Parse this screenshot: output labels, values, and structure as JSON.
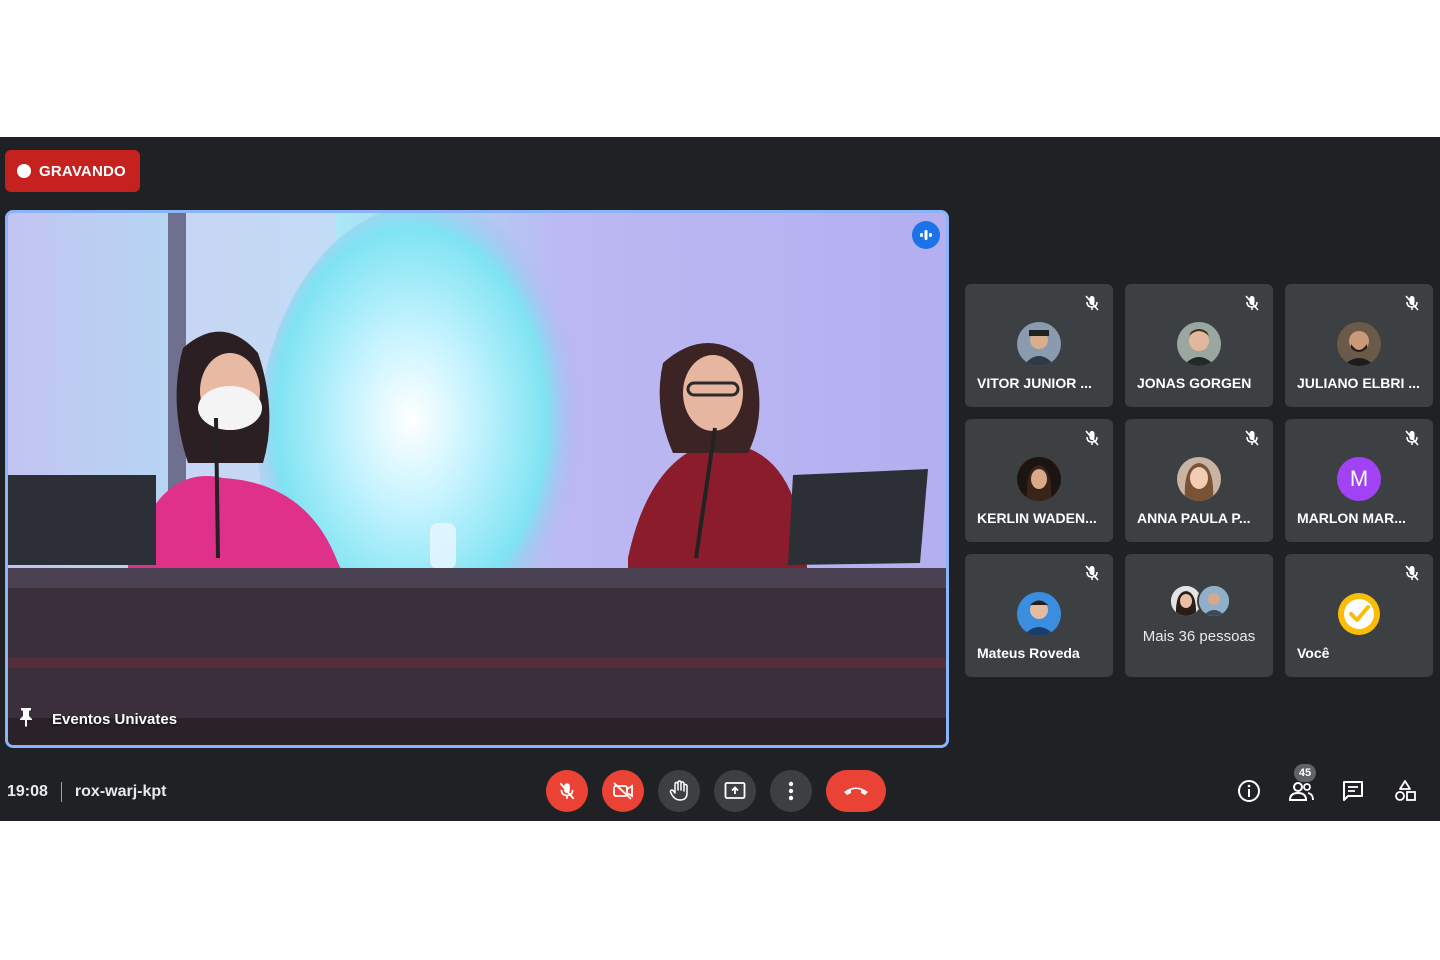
{
  "recording": {
    "label": "GRAVANDO",
    "color": "#c5221f"
  },
  "main_video": {
    "pinned_name": "Eventos Univates",
    "speaking_icon": "audio-level-icon",
    "pin_icon": "pin-icon"
  },
  "participants": [
    {
      "name": "VITOR JUNIOR ...",
      "muted": true,
      "avatar": "photo"
    },
    {
      "name": "JONAS GORGEN",
      "muted": true,
      "avatar": "photo"
    },
    {
      "name": "JULIANO ELBRI ...",
      "muted": true,
      "avatar": "photo"
    },
    {
      "name": "KERLIN WADEN...",
      "muted": true,
      "avatar": "photo"
    },
    {
      "name": "ANNA PAULA P...",
      "muted": true,
      "avatar": "photo"
    },
    {
      "name": "MARLON MAR...",
      "muted": true,
      "avatar": "letter",
      "letter": "M",
      "color": "#a142f4"
    },
    {
      "name": "Mateus Roveda",
      "muted": true,
      "avatar": "photo"
    },
    {
      "name": "Mais 36 pessoas",
      "muted": false,
      "avatar": "group"
    },
    {
      "name": "Você",
      "muted": true,
      "avatar": "check"
    }
  ],
  "bottom_bar": {
    "time": "19:08",
    "meeting_code": "rox-warj-kpt",
    "controls": [
      "mic-off-icon",
      "camera-off-icon",
      "raise-hand-icon",
      "present-screen-icon",
      "more-options-icon",
      "hang-up-icon"
    ],
    "people_count": "45",
    "right_icons": [
      "info-icon",
      "people-icon",
      "chat-icon",
      "activities-icon"
    ]
  },
  "colors": {
    "background": "#202124",
    "tile": "#3c4043",
    "active_border": "#8ab4f8",
    "danger": "#ea4335"
  }
}
